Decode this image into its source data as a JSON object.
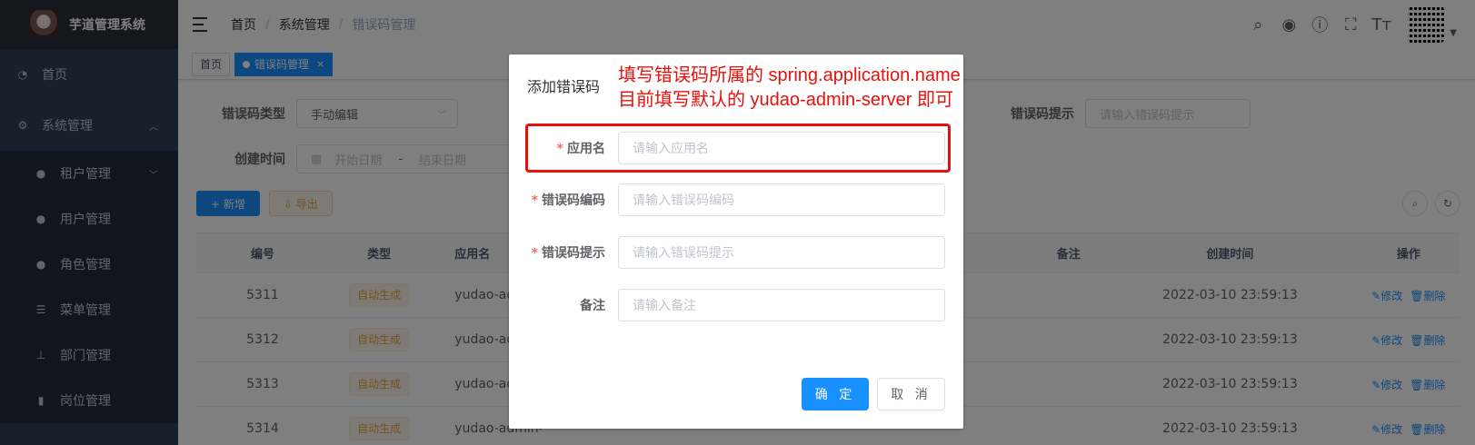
{
  "app": {
    "title": "芋道管理系统"
  },
  "sidebar": {
    "items": [
      {
        "label": "首页",
        "icon": "dashboard-icon"
      },
      {
        "label": "系统管理",
        "icon": "gear-icon",
        "expanded": true
      },
      {
        "label": "租户管理",
        "icon": "peoples-icon",
        "collapsible": true
      },
      {
        "label": "用户管理",
        "icon": "user-icon"
      },
      {
        "label": "角色管理",
        "icon": "peoples-icon"
      },
      {
        "label": "菜单管理",
        "icon": "tree-table-icon"
      },
      {
        "label": "部门管理",
        "icon": "tree-icon"
      },
      {
        "label": "岗位管理",
        "icon": "post-icon"
      }
    ]
  },
  "navbar": {
    "breadcrumb": [
      "首页",
      "系统管理",
      "错误码管理"
    ],
    "icons": [
      "search-icon",
      "github-icon",
      "question-icon",
      "fullscreen-icon",
      "font-size-icon"
    ]
  },
  "tags": {
    "home": "首页",
    "active": "错误码管理",
    "close": "×"
  },
  "search": {
    "type_label": "错误码类型",
    "type_value": "手动编辑",
    "tip_label": "错误码提示",
    "tip_placeholder": "请输入错误码提示",
    "time_label": "创建时间",
    "start_placeholder": "开始日期",
    "range_sep": "-",
    "end_placeholder": "结束日期"
  },
  "toolbar": {
    "add_label": "+ 新增",
    "export_label": "⇩ 导出"
  },
  "table": {
    "headers": {
      "id": "编号",
      "type": "类型",
      "app": "应用名",
      "remark": "备注",
      "time": "创建时间",
      "ops": "操作"
    },
    "rows": [
      {
        "id": "5311",
        "type": "自动生成",
        "app": "yudao-admin-server",
        "time": "2022-03-10 23:59:13"
      },
      {
        "id": "5312",
        "type": "自动生成",
        "app": "yudao-admin-server",
        "time": "2022-03-10 23:59:13"
      },
      {
        "id": "5313",
        "type": "自动生成",
        "app": "yudao-admin-server",
        "time": "2022-03-10 23:59:13"
      },
      {
        "id": "5314",
        "type": "自动生成",
        "app": "yudao-admin-server",
        "time": "2022-03-10 23:59:13"
      }
    ],
    "edit_label": "修改",
    "delete_label": "删除"
  },
  "dialog": {
    "title": "添加错误码",
    "annotation_line1": "填写错误码所属的 spring.application.name",
    "annotation_line2": "目前填写默认的 yudao-admin-server 即可",
    "fields": [
      {
        "label": "应用名",
        "required": "*",
        "placeholder": "请输入应用名"
      },
      {
        "label": "错误码编码",
        "required": "*",
        "placeholder": "请输入错误码编码"
      },
      {
        "label": "错误码提示",
        "required": "*",
        "placeholder": "请输入错误码提示"
      },
      {
        "label": "备注",
        "required": "",
        "placeholder": "请输入备注"
      }
    ],
    "confirm_label": "确 定",
    "cancel_label": "取 消"
  },
  "colors": {
    "primary": "#1890ff",
    "sidebar": "#304156",
    "annotation": "#e8100b",
    "warning": "#e6a23c"
  }
}
